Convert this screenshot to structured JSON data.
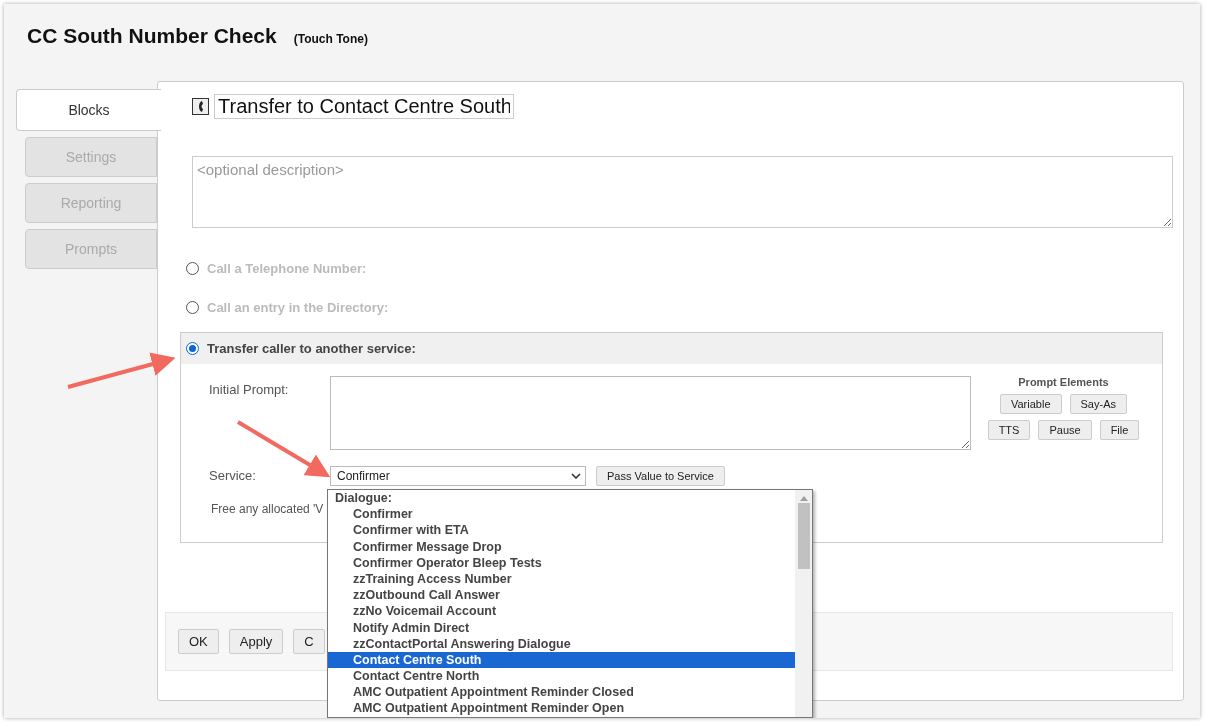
{
  "window": {
    "title": "CC South Number Check",
    "subtitle": "(Touch Tone)"
  },
  "tabs": [
    {
      "label": "Blocks",
      "selected": true
    },
    {
      "label": "Settings",
      "selected": false
    },
    {
      "label": "Reporting",
      "selected": false
    },
    {
      "label": "Prompts",
      "selected": false
    }
  ],
  "block": {
    "name": "Transfer to Contact Centre South",
    "description_placeholder": "<optional description>"
  },
  "options": [
    {
      "label": "Call a Telephone Number:",
      "selected": false
    },
    {
      "label": "Call an entry in the Directory:",
      "selected": false
    },
    {
      "label": "Transfer caller to another service:",
      "selected": true
    }
  ],
  "transfer": {
    "initial_prompt_label": "Initial Prompt:",
    "prompt_elements_title": "Prompt Elements",
    "prompt_elements": [
      [
        "Variable",
        "Say-As"
      ],
      [
        "TTS",
        "Pause",
        "File"
      ]
    ],
    "service_label": "Service:",
    "service_value": "Confirmer",
    "pass_value_button": "Pass Value to Service",
    "free_text": "Free any allocated 'V"
  },
  "service_dropdown": {
    "group": "Dialogue:",
    "items": [
      {
        "label": "Confirmer",
        "selected": false
      },
      {
        "label": "Confirmer with ETA",
        "selected": false
      },
      {
        "label": "Confirmer Message Drop",
        "selected": false
      },
      {
        "label": "Confirmer Operator Bleep Tests",
        "selected": false
      },
      {
        "label": "zzTraining Access Number",
        "selected": false
      },
      {
        "label": "zzOutbound Call Answer",
        "selected": false
      },
      {
        "label": "zzNo Voicemail Account",
        "selected": false
      },
      {
        "label": "Notify Admin Direct",
        "selected": false
      },
      {
        "label": "zzContactPortal Answering Dialogue",
        "selected": false
      },
      {
        "label": "Contact Centre South",
        "selected": true
      },
      {
        "label": "Contact Centre North",
        "selected": false
      },
      {
        "label": "AMC Outpatient Appointment Reminder Closed",
        "selected": false
      },
      {
        "label": "AMC Outpatient Appointment Reminder Open",
        "selected": false
      }
    ]
  },
  "footer_buttons": [
    "OK",
    "Apply",
    "C"
  ]
}
